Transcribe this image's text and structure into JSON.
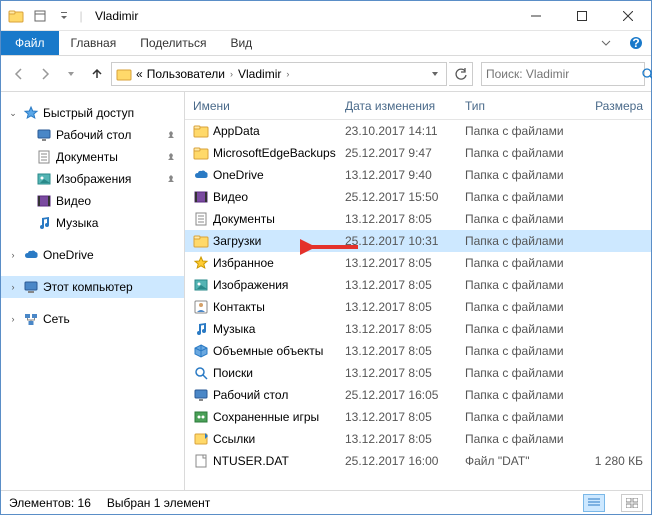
{
  "titlebar": {
    "title": "Vladimir"
  },
  "ribbon": {
    "file": "Файл",
    "tabs": [
      "Главная",
      "Поделиться",
      "Вид"
    ]
  },
  "breadcrumb": {
    "items": [
      "Пользователи",
      "Vladimir"
    ],
    "prefix": "«"
  },
  "search": {
    "placeholder": "Поиск: Vladimir"
  },
  "navpane": {
    "quick": {
      "label": "Быстрый доступ",
      "children": [
        {
          "label": "Рабочий стол",
          "pin": true,
          "icon": "desktop"
        },
        {
          "label": "Документы",
          "pin": true,
          "icon": "documents"
        },
        {
          "label": "Изображения",
          "pin": true,
          "icon": "pictures"
        },
        {
          "label": "Видео",
          "pin": false,
          "icon": "videos"
        },
        {
          "label": "Музыка",
          "pin": false,
          "icon": "music"
        }
      ]
    },
    "onedrive": {
      "label": "OneDrive"
    },
    "thispc": {
      "label": "Этот компьютер"
    },
    "network": {
      "label": "Сеть"
    }
  },
  "columns": {
    "name": "Имени",
    "date": "Дата изменения",
    "type": "Тип",
    "size": "Размера"
  },
  "rows": [
    {
      "icon": "folder",
      "name": "AppData",
      "date": "23.10.2017 14:11",
      "type": "Папка с файлами",
      "size": ""
    },
    {
      "icon": "folder",
      "name": "MicrosoftEdgeBackups",
      "date": "25.12.2017 9:47",
      "type": "Папка с файлами",
      "size": ""
    },
    {
      "icon": "onedrive",
      "name": "OneDrive",
      "date": "13.12.2017 9:40",
      "type": "Папка с файлами",
      "size": ""
    },
    {
      "icon": "videos",
      "name": "Видео",
      "date": "25.12.2017 15:50",
      "type": "Папка с файлами",
      "size": ""
    },
    {
      "icon": "documents",
      "name": "Документы",
      "date": "13.12.2017 8:05",
      "type": "Папка с файлами",
      "size": ""
    },
    {
      "icon": "folder",
      "name": "Загрузки",
      "date": "25.12.2017 10:31",
      "type": "Папка с файлами",
      "size": "",
      "selected": true
    },
    {
      "icon": "favorites",
      "name": "Избранное",
      "date": "13.12.2017 8:05",
      "type": "Папка с файлами",
      "size": ""
    },
    {
      "icon": "pictures",
      "name": "Изображения",
      "date": "13.12.2017 8:05",
      "type": "Папка с файлами",
      "size": ""
    },
    {
      "icon": "contacts",
      "name": "Контакты",
      "date": "13.12.2017 8:05",
      "type": "Папка с файлами",
      "size": ""
    },
    {
      "icon": "music",
      "name": "Музыка",
      "date": "13.12.2017 8:05",
      "type": "Папка с файлами",
      "size": ""
    },
    {
      "icon": "3d",
      "name": "Объемные объекты",
      "date": "13.12.2017 8:05",
      "type": "Папка с файлами",
      "size": ""
    },
    {
      "icon": "search",
      "name": "Поиски",
      "date": "13.12.2017 8:05",
      "type": "Папка с файлами",
      "size": ""
    },
    {
      "icon": "desktop",
      "name": "Рабочий стол",
      "date": "25.12.2017 16:05",
      "type": "Папка с файлами",
      "size": ""
    },
    {
      "icon": "saved",
      "name": "Сохраненные игры",
      "date": "13.12.2017 8:05",
      "type": "Папка с файлами",
      "size": ""
    },
    {
      "icon": "links",
      "name": "Ссылки",
      "date": "13.12.2017 8:05",
      "type": "Папка с файлами",
      "size": ""
    },
    {
      "icon": "file",
      "name": "NTUSER.DAT",
      "date": "25.12.2017 16:00",
      "type": "Файл \"DAT\"",
      "size": "1 280 КБ"
    }
  ],
  "status": {
    "count": "Элементов: 16",
    "selection": "Выбран 1 элемент"
  }
}
